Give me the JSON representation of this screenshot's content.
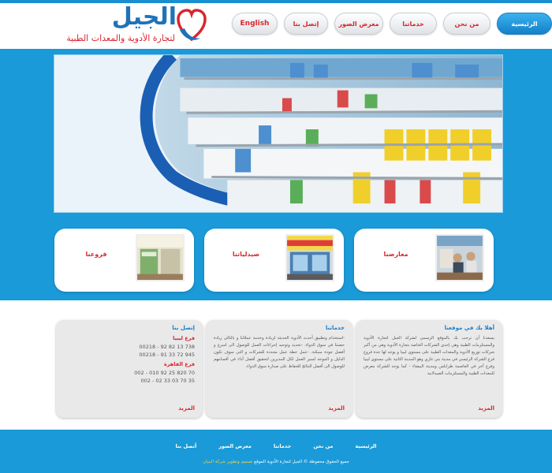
{
  "brand": {
    "name": "الجيل",
    "tagline": "لتجارة الأدوية والمعدات الطبية",
    "colors": {
      "primary": "#1a9ad8",
      "accent": "#d8262e"
    }
  },
  "nav": {
    "items": [
      {
        "label": "الرئيسية",
        "active": true
      },
      {
        "label": "من نحن"
      },
      {
        "label": "خدماتنا"
      },
      {
        "label": "معرض الصور"
      },
      {
        "label": "إتصل بنا"
      },
      {
        "label": "English"
      }
    ]
  },
  "cards": [
    {
      "title": "معارضنا"
    },
    {
      "title": "صيدلياتنا"
    },
    {
      "title": "فروعنا"
    }
  ],
  "welcome": {
    "title": "أهلا بك في موقعنا",
    "text": "يسعدنا أن نرحب بك بالموقع الرسمي لشركة الجيل لتجارة الأدوية والمستلزمات الطبية وهي إحدى الشركات الخاصة بتجارة الأدوية وهي من أكبر شركات توزيع الأدوية والمعدات الطبية على مستوى ليبيا و يوجد لها عدة فروع فرع الشركة الرئيسي في مدينة بني غازي وهو المدينة الثانية على مستوى ليبيا وفرع آخر في العاصمة طرابلس ومدينة البيضاء - كما يوجد للشركة معرض للمعدات الطبية والمستلزمات الصيدلانية",
    "more": "المزيد"
  },
  "services": {
    "title": "خدماتنا",
    "text": "-استخدام وتطبيق أحدث الأدوية الحديثة لزيادة وخدمة عملائنا و بالتالي زيادة حصتنا في سوق الدواء. -تحديد وتوحيد إجراءات العمل للوصول الى اسرع و أفضل جودة ممكنة. -عمل خطة عمل محددة للشركات و التي سوف تكون الدليل و الموجه لسير العمل لكل المديرين لتحقيق أفضل أداء في أقسامهم للوصول الى أفضل النتائج للحفاظ على صدارة سوق الدواء.",
    "more": "المزيد"
  },
  "contact": {
    "title": "إتصل بنا",
    "branches": [
      {
        "name": "فرع ليبيا",
        "phones": [
          "00218 - 92 82 13 738",
          "00218 - 91 33 72 945"
        ]
      },
      {
        "name": "فرع القاهرة",
        "phones": [
          "002 - 010 92 25 820 70",
          "002 - 02 33 03 70 35"
        ]
      }
    ],
    "more": "المزيد"
  },
  "footer": {
    "links": [
      "الرئيسية",
      "من نحن",
      "خدماتنا",
      "معرض الصور",
      "أتصل بنا"
    ],
    "copyright": "جميع الحقوق محفوظة © الجيل لتجارة الأدوية الموقع",
    "developer": "تصميم وتطوير شركة البنيان"
  }
}
